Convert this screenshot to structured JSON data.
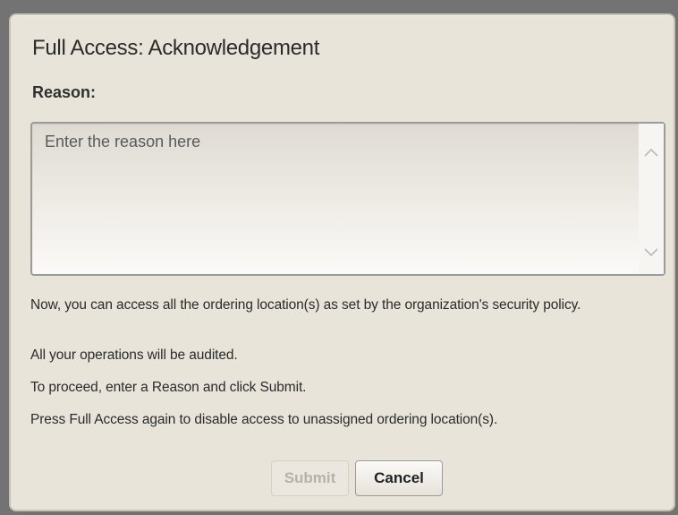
{
  "dialog": {
    "title": "Full Access: Acknowledgement",
    "reason_label": "Reason:",
    "reason_input": {
      "value": "",
      "placeholder": "Enter the reason here"
    },
    "messages": [
      "Now, you can access all the ordering location(s) as set by the organization's security policy.",
      "All your operations will be audited.",
      "To proceed, enter a Reason and click Submit.",
      "Press Full Access again to disable access to unassigned ordering location(s)."
    ],
    "buttons": {
      "submit_label": "Submit",
      "submit_disabled": true,
      "cancel_label": "Cancel"
    },
    "icons": {
      "scroll_up": "chevron-up-icon",
      "scroll_down": "chevron-down-icon"
    },
    "colors": {
      "dialog_background": "#e9e4da",
      "overlay": "#737373",
      "disabled_text": "#b6b2aa"
    }
  }
}
